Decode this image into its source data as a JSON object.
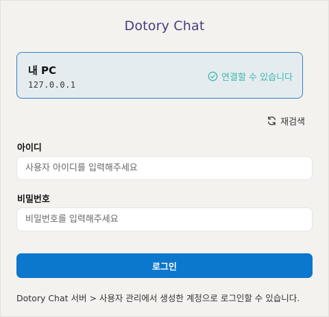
{
  "app": {
    "title": "Dotory Chat"
  },
  "server": {
    "name": "내 PC",
    "address": "127.0.0.1",
    "status": "연결할 수 있습니다",
    "status_icon": "check-circle-icon",
    "status_color": "#3fb6ab",
    "border_color": "#2f7fc4"
  },
  "rescan": {
    "label": "재검색",
    "icon": "refresh-icon"
  },
  "username": {
    "label": "아이디",
    "value": "",
    "placeholder": "사용자 아이디를 입력해주세요"
  },
  "password": {
    "label": "비밀번호",
    "value": "",
    "placeholder": "비밀번호를 입력해주세요"
  },
  "login": {
    "label": "로그인",
    "color": "#0b77cd"
  },
  "footnote": "Dotory Chat 서버 > 사용자 관리에서 생성한 계정으로 로그인할 수 있습니다."
}
